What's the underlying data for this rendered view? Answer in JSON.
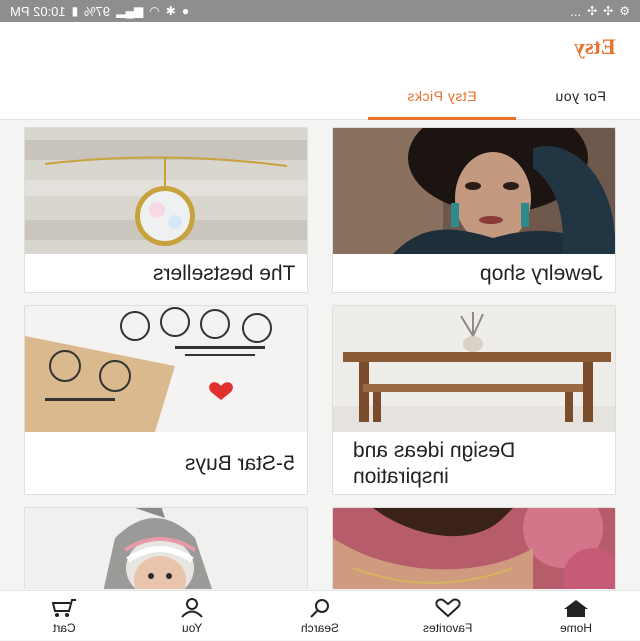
{
  "status_bar": {
    "time": "10:02 PM",
    "battery": "97%",
    "dots": "..."
  },
  "header": {
    "logo": "Etsy"
  },
  "tabs": [
    {
      "label": "For you",
      "active": false
    },
    {
      "label": "Etsy Picks",
      "active": true
    }
  ],
  "cards": [
    {
      "caption": "Jewelry shop",
      "image": "woman-earrings-photo"
    },
    {
      "caption": "The bestsellers",
      "image": "opal-necklace-photo"
    },
    {
      "caption": "Design ideas and inspiration",
      "image": "wooden-table-photo"
    },
    {
      "caption": "5-Star Buys",
      "image": "portrait-stamp-photo"
    },
    {
      "caption": "",
      "image": "necklace-model-photo"
    },
    {
      "caption": "",
      "image": "shark-costume-photo"
    }
  ],
  "bottom_nav": [
    {
      "label": "Home",
      "icon": "home-icon"
    },
    {
      "label": "Favorites",
      "icon": "heart-icon"
    },
    {
      "label": "Search",
      "icon": "search-icon"
    },
    {
      "label": "You",
      "icon": "user-icon"
    },
    {
      "label": "Cart",
      "icon": "cart-icon"
    }
  ],
  "colors": {
    "accent": "#e9712b",
    "status_bar": "#8e8e8e"
  }
}
